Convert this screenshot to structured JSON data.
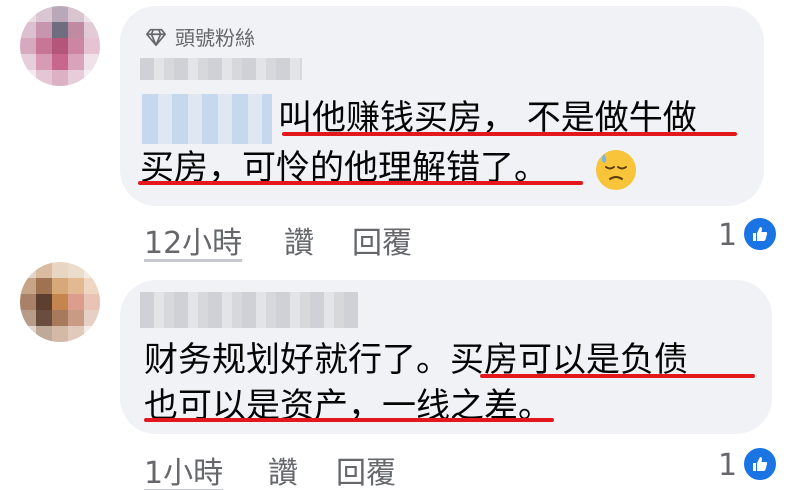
{
  "comments": [
    {
      "badge": "頭號粉絲",
      "lines": [
        "叫他赚钱买房， 不是做牛做",
        "买房，可怜的他理解错了。"
      ],
      "time": "12小時",
      "like_label": "讚",
      "reply_label": "回覆",
      "reactions": "1"
    },
    {
      "lines": [
        "财务规划好就行了。买房可以是负债",
        "也可以是资产，一线之差。"
      ],
      "time": "1小時",
      "like_label": "讚",
      "reply_label": "回覆",
      "reactions": "1"
    }
  ],
  "colors": {
    "bubble": "#f0f2f5",
    "underline": "#e4181c",
    "meta": "#65676b",
    "like": "#1b74e4"
  },
  "icons": [
    "diamond-icon",
    "downcast-sweat-emoji",
    "like-icon"
  ]
}
